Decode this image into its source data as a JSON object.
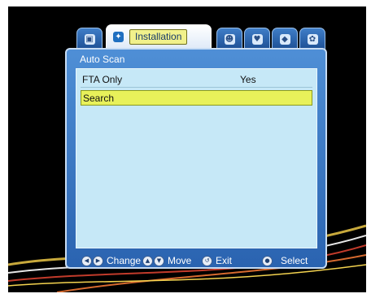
{
  "tabs": [
    {
      "icon": "tv-icon",
      "glyph": "▣"
    },
    {
      "icon": "satellite-icon",
      "glyph": "✦",
      "label": "Installation"
    },
    {
      "icon": "people-icon",
      "glyph": "☻"
    },
    {
      "icon": "heart-icon",
      "glyph": "♥"
    },
    {
      "icon": "lock-icon",
      "glyph": "◆"
    },
    {
      "icon": "settings-icon",
      "glyph": "✿"
    }
  ],
  "panel": {
    "title": "Auto Scan",
    "rows": [
      {
        "label": "FTA Only",
        "value": "Yes"
      },
      {
        "label": "Search",
        "value": ""
      }
    ]
  },
  "footer": {
    "change_label": "Change",
    "move_label": "Move",
    "exit_label": "Exit",
    "select_label": "Select"
  },
  "colors": {
    "panel": "#3a78c8",
    "list": "#c6e8f7",
    "highlight": "#e8f15a",
    "screen": "#000000"
  }
}
